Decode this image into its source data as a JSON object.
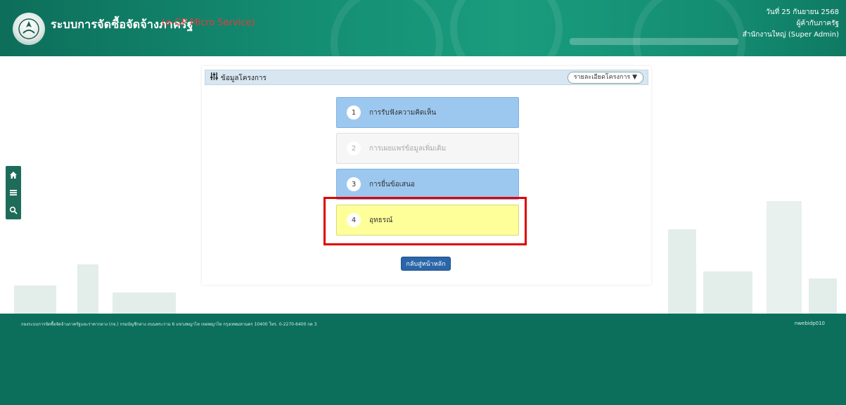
{
  "header": {
    "system_title": "ระบบการจัดซื้อจัดจ้างภาครัฐ",
    "system_subtitle": "(e-GP Micro Service)",
    "user_lines": [
      "วันที่ 25 กันยายน 2568",
      "ผู้ค้ากับภาครัฐ",
      "สำนักงานใหญ่ (Super Admin)"
    ]
  },
  "side_tools": [
    "home-icon",
    "menu-icon",
    "search-icon"
  ],
  "panel": {
    "title": "ข้อมูลโครงการ",
    "dropdown_label": "รายละเอียดโครงการ ▼",
    "steps": [
      {
        "number": "1",
        "label": "การรับฟังความคิดเห็น",
        "state": "active"
      },
      {
        "number": "2",
        "label": "การเผยแพร่ข้อมูลเพิ่มเติม",
        "state": "disabled"
      },
      {
        "number": "3",
        "label": "การยื่นข้อเสนอ",
        "state": "active"
      },
      {
        "number": "4",
        "label": "อุทธรณ์",
        "state": "current"
      }
    ],
    "back_button": "กลับสู่หน้าหลัก"
  },
  "footer": {
    "address": "กองระบบการจัดซื้อจัดจ้างภาครัฐและราคากลาง (กจ.) กรมบัญชีกลาง ถนนพระราม 6 แขวงพญาไท เขตพญาไท กรุงเทพมหานคร 10400 โทร. 0-2270-6400 กด 3",
    "page_code": "nwebidp010"
  },
  "colors": {
    "header_green": "#148d72",
    "footer_green": "#0c6f5c",
    "step_blue": "#9cc8f0",
    "step_yellow": "#ffff99",
    "highlight_red": "#e00000",
    "button_blue": "#2a66a8"
  }
}
